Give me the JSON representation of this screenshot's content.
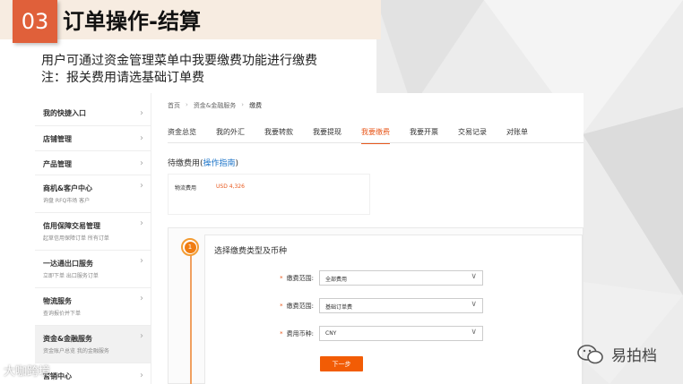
{
  "slide": {
    "number": "03",
    "title": "订单操作-结算",
    "subtitle1": "用户可通过资金管理菜单中我要缴费功能进行缴费",
    "subtitle2": "注：报关费用请选基础订单费"
  },
  "sidebar": {
    "items": [
      {
        "label": "我的快捷入口",
        "sub": ""
      },
      {
        "label": "店铺管理",
        "sub": ""
      },
      {
        "label": "产品管理",
        "sub": ""
      },
      {
        "label": "商机&客户中心",
        "sub": "询盘   RFQ市场   客户"
      },
      {
        "label": "信用保障交易管理",
        "sub": "起草信用保障订单   所有订单"
      },
      {
        "label": "一达通出口服务",
        "sub": "立即下单   出口服务订单"
      },
      {
        "label": "物流服务",
        "sub": "查询报价并下单"
      },
      {
        "label": "资金&金融服务",
        "sub": "资金账户总览   我的金融服务"
      },
      {
        "label": "营销中心",
        "sub": ""
      }
    ]
  },
  "breadcrumb": [
    "首页",
    "资金&金融服务",
    "缴费"
  ],
  "tabs": [
    "资金总览",
    "我的外汇",
    "我要转款",
    "我要提现",
    "我要缴费",
    "我要开票",
    "交易记录",
    "对账单"
  ],
  "active_tab": "我要缴费",
  "pending": {
    "title": "待缴费用(",
    "guide_link": "操作指南",
    "title_end": ")",
    "fee_label": "物流费用",
    "fee_amount": "USD 4,326"
  },
  "form": {
    "step": "1",
    "title": "选择缴费类型及币种",
    "fields": [
      {
        "label": "缴费范围:",
        "value": "全部费用"
      },
      {
        "label": "缴费范围:",
        "value": "基础订单费"
      },
      {
        "label": "费用币种:",
        "value": "CNY"
      }
    ],
    "required_mark": "*",
    "next_button": "下一步"
  },
  "watermarks": {
    "left": "大咖跨境",
    "right": "易拍档"
  },
  "colors": {
    "accent": "#e8581c",
    "number_box": "#e0603a",
    "header_bg": "#f7ece1",
    "link": "#1a73c8"
  }
}
